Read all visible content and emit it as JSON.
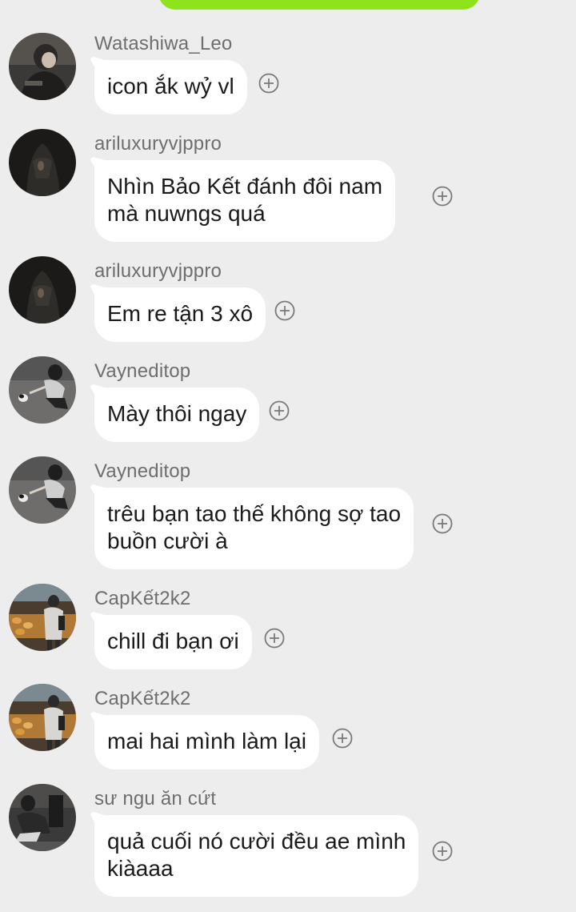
{
  "colors": {
    "background": "#ededed",
    "accent_pill": "#8fe31b",
    "bubble": "#ffffff",
    "username": "#6e6e6e",
    "text": "#1a1a1a"
  },
  "messages": [
    {
      "username": "Watashiwa_Leo",
      "lines": [
        "icon ắk wỷ vl"
      ],
      "avatar_icon": "avatar-dark-hoodie"
    },
    {
      "username": "ariluxuryvjppro",
      "lines": [
        "Nhìn Bảo Kết đánh đôi nam",
        "mà nuwngs quá"
      ],
      "avatar_icon": "avatar-dark-person"
    },
    {
      "username": "ariluxuryvjppro",
      "lines": [
        "Em re tận 3 xô"
      ],
      "avatar_icon": "avatar-dark-person"
    },
    {
      "username": "Vayneditop",
      "lines": [
        "Mày thôi ngay"
      ],
      "avatar_icon": "avatar-crouching-with-cat"
    },
    {
      "username": "Vayneditop",
      "lines": [
        "trêu bạn tao thế không sợ tao",
        "buồn cười à"
      ],
      "avatar_icon": "avatar-crouching-with-cat"
    },
    {
      "username": "CapKết2k2",
      "lines": [
        "chill đi bạn ơi"
      ],
      "avatar_icon": "avatar-bakery"
    },
    {
      "username": "CapKết2k2",
      "lines": [
        "mai hai mình làm lại"
      ],
      "avatar_icon": "avatar-bakery"
    },
    {
      "username": "sư ngu ăn cứt",
      "lines": [
        "quả cuối nó cười đều ae mình",
        "kiàaaa"
      ],
      "avatar_icon": "avatar-dark-figure"
    }
  ]
}
